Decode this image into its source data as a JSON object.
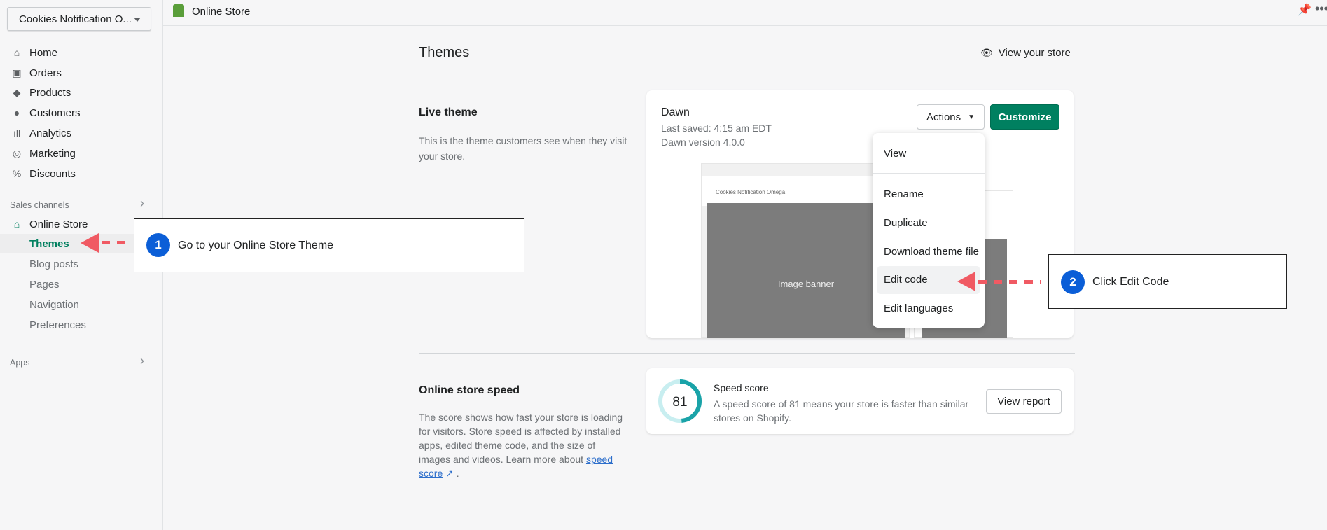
{
  "store_selector": "Cookies Notification O...",
  "topbar": {
    "title": "Online Store"
  },
  "sidebar": {
    "items": [
      {
        "label": "Home",
        "icon": "home-icon"
      },
      {
        "label": "Orders",
        "icon": "orders-icon"
      },
      {
        "label": "Products",
        "icon": "tag-icon"
      },
      {
        "label": "Customers",
        "icon": "person-icon"
      },
      {
        "label": "Analytics",
        "icon": "bar-chart-icon"
      },
      {
        "label": "Marketing",
        "icon": "target-icon"
      },
      {
        "label": "Discounts",
        "icon": "discount-icon"
      }
    ],
    "sales_channels": "Sales channels",
    "online_store": "Online Store",
    "sub_items": [
      "Themes",
      "Blog posts",
      "Pages",
      "Navigation",
      "Preferences"
    ],
    "apps": "Apps"
  },
  "page": {
    "title": "Themes",
    "view_store": "View your store"
  },
  "live": {
    "heading": "Live theme",
    "description": "This is the theme customers see when they visit your store.",
    "theme_name": "Dawn",
    "last_saved": "Last saved: 4:15 am EDT",
    "version": "Dawn version 4.0.0",
    "actions": "Actions",
    "customize": "Customize",
    "preview_store": "Cookies Notification Omega",
    "preview_banner": "Image banner"
  },
  "actions_menu": [
    "View",
    "Rename",
    "Duplicate",
    "Download theme file",
    "Edit code",
    "Edit languages"
  ],
  "speed": {
    "heading": "Online store speed",
    "description": "The score shows how fast your store is loading for visitors. Store speed is affected by installed apps, edited theme code, and the size of images and videos. Learn more about",
    "link": "speed score",
    "period": ".",
    "score": "81",
    "score_value": 81,
    "card_title": "Speed score",
    "card_text": "A speed score of 81 means your store is faster than similar stores on Shopify.",
    "view_report": "View report"
  },
  "callouts": [
    {
      "number": "1",
      "text": "Go to your Online Store Theme"
    },
    {
      "number": "2",
      "text": "Click Edit Code"
    }
  ],
  "colors": {
    "primary": "#008060",
    "callout_number": "#0b5ed7",
    "arrow": "#f05a63",
    "gauge": "#1aa3a8"
  }
}
